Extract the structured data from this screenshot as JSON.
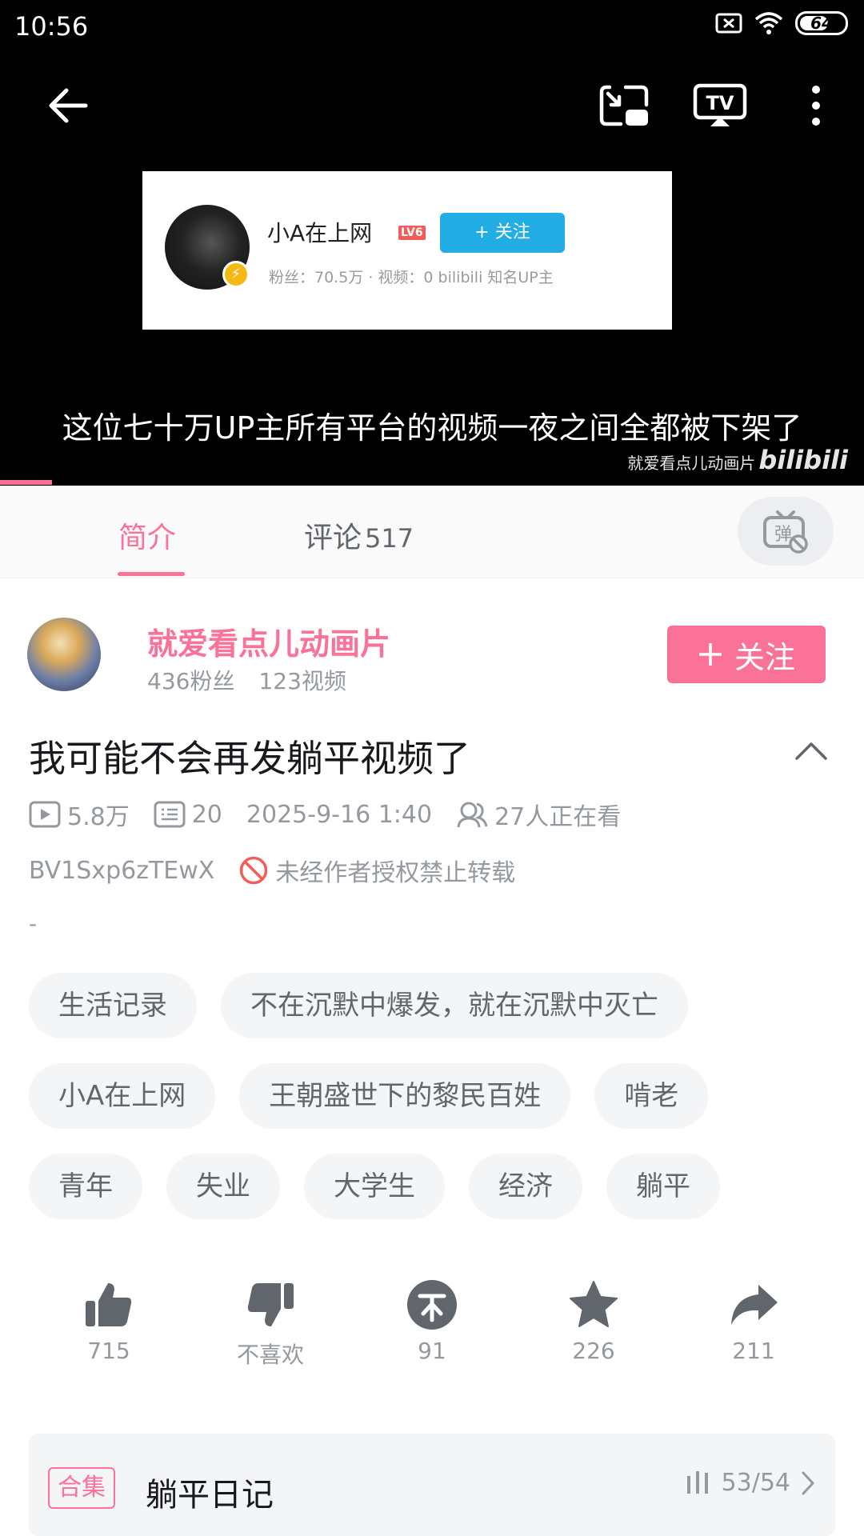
{
  "status_bar": {
    "time": "10:56",
    "battery": "64",
    "battery_level": 0.64
  },
  "player": {
    "embed_card": {
      "name": "小A在上网",
      "level": "LV6",
      "follow_label": "+ 关注",
      "stats": "粉丝：70.5万 · 视频：0  bilibili 知名UP主"
    },
    "subtitle": "这位七十万UP主所有平台的视频一夜之间全都被下架了",
    "watermark_text": "就爱看点儿动画片",
    "watermark_logo": "bilibili",
    "progress": 0.06
  },
  "tabs": {
    "intro": "简介",
    "comments": "评论",
    "comments_count": "517"
  },
  "uploader": {
    "name": "就爱看点儿动画片",
    "fans": "436粉丝",
    "videos": "123视频",
    "follow_label": "关注"
  },
  "video": {
    "title": "我可能不会再发躺平视频了",
    "views": "5.8万",
    "danmaku": "20",
    "date": "2025-9-16 1:40",
    "watching": "27人正在看",
    "bvid": "BV1Sxp6zTEwX",
    "copyright": "未经作者授权禁止转载",
    "description": "-"
  },
  "tags": [
    [
      "生活记录",
      "不在沉默中爆发，就在沉默中灭亡"
    ],
    [
      "小A在上网",
      "王朝盛世下的黎民百姓",
      "啃老"
    ],
    [
      "青年",
      "失业",
      "大学生",
      "经济",
      "躺平"
    ]
  ],
  "actions": {
    "like": "715",
    "dislike": "不喜欢",
    "coin": "91",
    "favorite": "226",
    "share": "211"
  },
  "collection": {
    "badge": "合集",
    "title": "躺平日记",
    "progress": "53/54"
  },
  "colors": {
    "accent": "#fb7299",
    "text_secondary": "#9499a0",
    "tag_bg": "#f4f5f7"
  }
}
